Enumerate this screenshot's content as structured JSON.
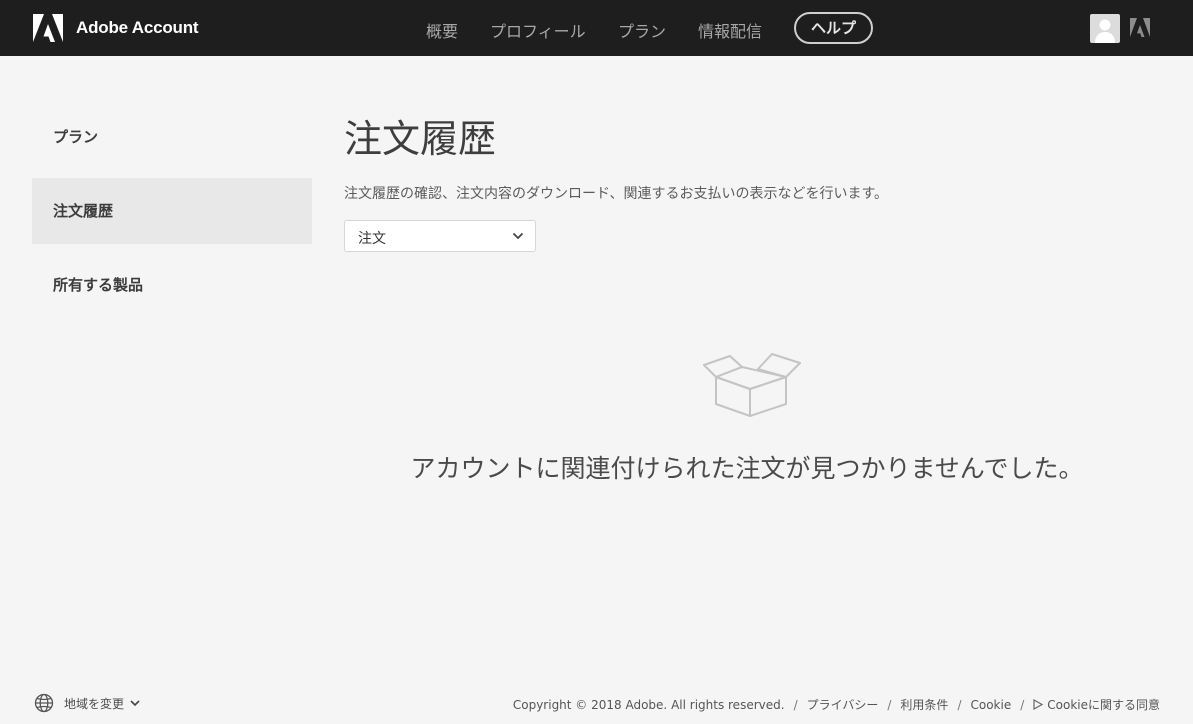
{
  "header": {
    "brand_name": "Adobe Account",
    "nav": [
      {
        "label": "概要"
      },
      {
        "label": "プロフィール"
      },
      {
        "label": "プラン"
      },
      {
        "label": "情報配信"
      }
    ],
    "help_label": "ヘルプ"
  },
  "sidebar": {
    "items": [
      {
        "label": "プラン",
        "active": false
      },
      {
        "label": "注文履歴",
        "active": true
      },
      {
        "label": "所有する製品",
        "active": false
      }
    ]
  },
  "main": {
    "title": "注文履歴",
    "description": "注文履歴の確認、注文内容のダウンロード、関連するお支払いの表示などを行います。",
    "filter_select": {
      "value": "注文"
    },
    "empty_message": "アカウントに関連付けられた注文が見つかりませんでした。"
  },
  "footer": {
    "region_label": "地域を変更",
    "copyright": "Copyright © 2018 Adobe. All rights reserved.",
    "links": [
      {
        "label": "プライバシー"
      },
      {
        "label": "利用条件"
      },
      {
        "label": "Cookie"
      },
      {
        "label": "Cookieに関する同意"
      }
    ]
  },
  "icons": {
    "brand": "adobe-logo-icon",
    "avatar": "user-avatar-icon",
    "adobe_mini": "adobe-mini-icon",
    "chevron": "chevron-down-icon",
    "empty": "empty-box-icon",
    "globe": "globe-icon",
    "play": "play-icon"
  },
  "colors": {
    "header_bg": "#1e1e1e",
    "page_bg": "#f5f5f5",
    "active_item_bg": "#e8e8e8"
  }
}
